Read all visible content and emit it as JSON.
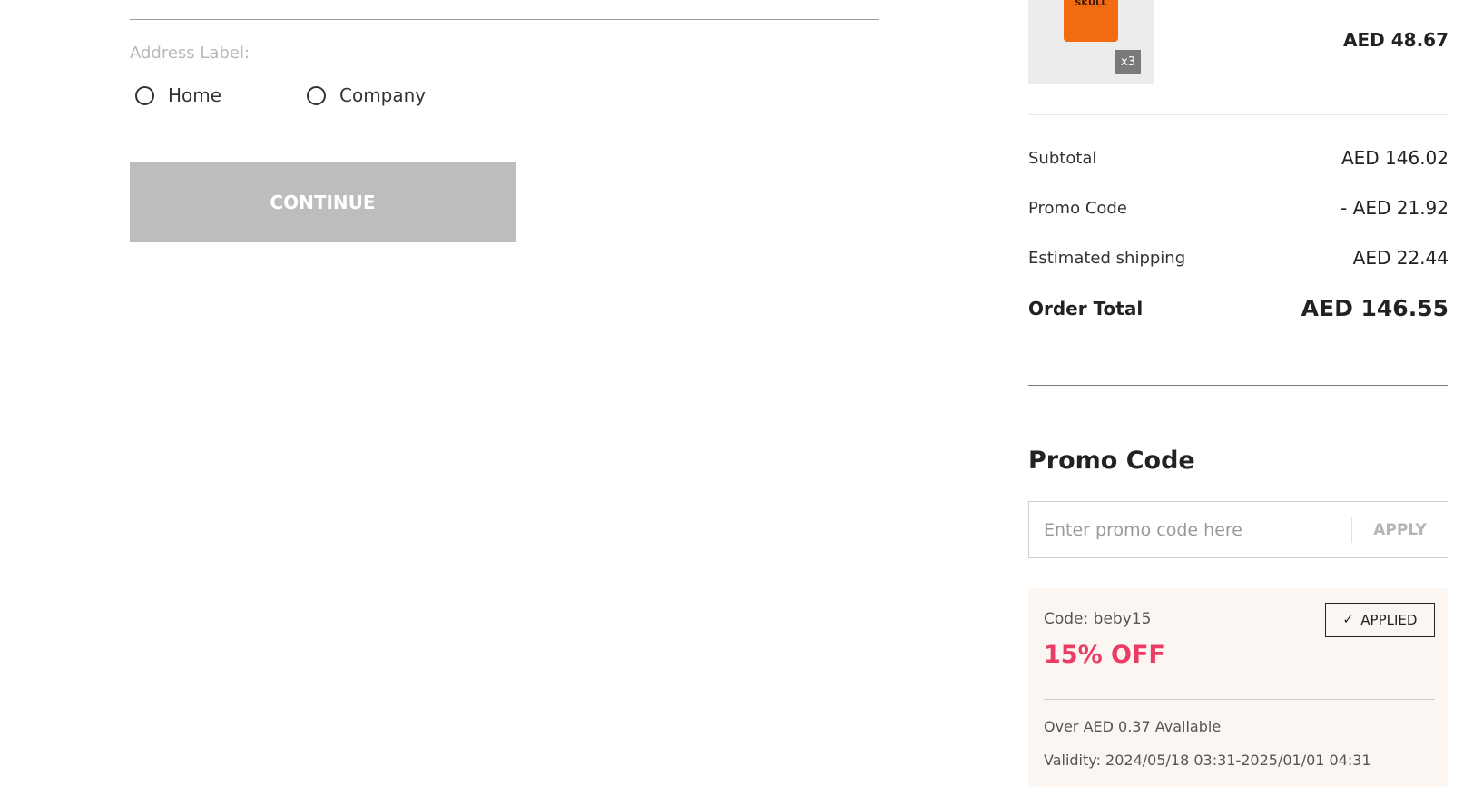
{
  "address": {
    "label": "Address Label:",
    "options": [
      {
        "label": "Home"
      },
      {
        "label": "Company"
      }
    ],
    "continue_label": "CONTINUE"
  },
  "order": {
    "item": {
      "image_text": "SKULL",
      "quantity_badge": "x3",
      "price": "AED 48.67"
    },
    "summary": {
      "subtotal_label": "Subtotal",
      "subtotal_value": "AED 146.02",
      "promo_label": "Promo Code",
      "promo_value": "- AED 21.92",
      "shipping_label": "Estimated shipping",
      "shipping_value": "AED 22.44",
      "total_label": "Order Total",
      "total_value": "AED 146.55"
    }
  },
  "promo": {
    "title": "Promo Code",
    "placeholder": "Enter promo code here",
    "apply_label": "APPLY",
    "coupon": {
      "code_text": "Code: beby15",
      "discount_text": "15% OFF",
      "applied_label": "APPLIED",
      "minimum_text": "Over AED 0.37 Available",
      "validity_text": "Validity: 2024/05/18 03:31-2025/01/01 04:31"
    }
  },
  "colors": {
    "accent_discount": "#ec3b65",
    "button_disabled": "#bdbdbd",
    "coupon_bg": "#fbf6f2",
    "product_shirt": "#f26b10"
  },
  "icons": [
    "radio-unchecked-icon",
    "check-icon"
  ]
}
